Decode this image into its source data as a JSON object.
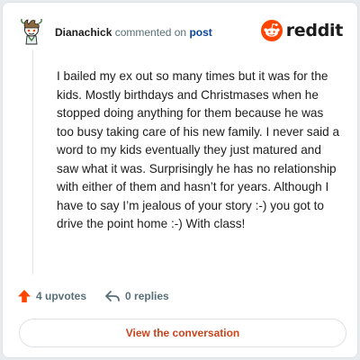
{
  "comment": {
    "username": "Dianachick",
    "action": "commented on",
    "post_link": "post",
    "body": "I bailed my ex out so many times but it was for the kids. Mostly birthdays and Christmases when he stopped doing anything for them because he was too busy taking care of his new family. I never said a word to my kids eventually they just matured and saw what it was. Surprisingly he has no relationship with either of them and hasn’t for years. Although I have to say I’m jealous of your story :-) you got to drive the point home :-) With class!"
  },
  "brand": {
    "name": "reddit",
    "logo_icon": "reddit-logo-icon",
    "color": "#ff4500"
  },
  "actions": {
    "upvotes_label": "4 upvotes",
    "upvote_icon": "upvote-arrow-icon",
    "upvote_color": "#ff4500",
    "replies_label": "0 replies",
    "reply_icon": "reply-arrow-icon"
  },
  "cta": {
    "label": "View the conversation",
    "color": "#c8441d"
  }
}
